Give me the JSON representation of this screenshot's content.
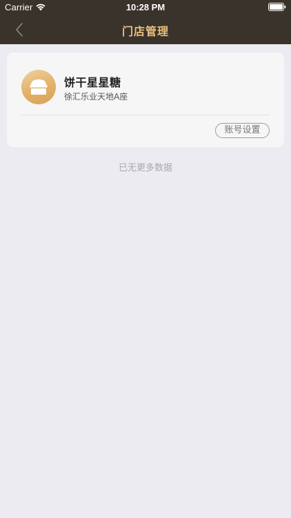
{
  "status_bar": {
    "carrier": "Carrier",
    "time": "10:28 PM"
  },
  "nav": {
    "title": "门店管理",
    "back_icon": "chevron-left-icon"
  },
  "colors": {
    "nav_background": "#3a332b",
    "nav_title": "#e9c07d",
    "page_background": "#ebebf1",
    "card_background": "#f6f6f6",
    "avatar_gradient": [
      "#f0d19c",
      "#d9a25a"
    ]
  },
  "stores": [
    {
      "name": "饼干星星糖",
      "address": "徐汇乐业天地A座",
      "avatar_icon": "store-icon",
      "settings_label": "账号设置"
    }
  ],
  "list_footer": "已无更多数据"
}
